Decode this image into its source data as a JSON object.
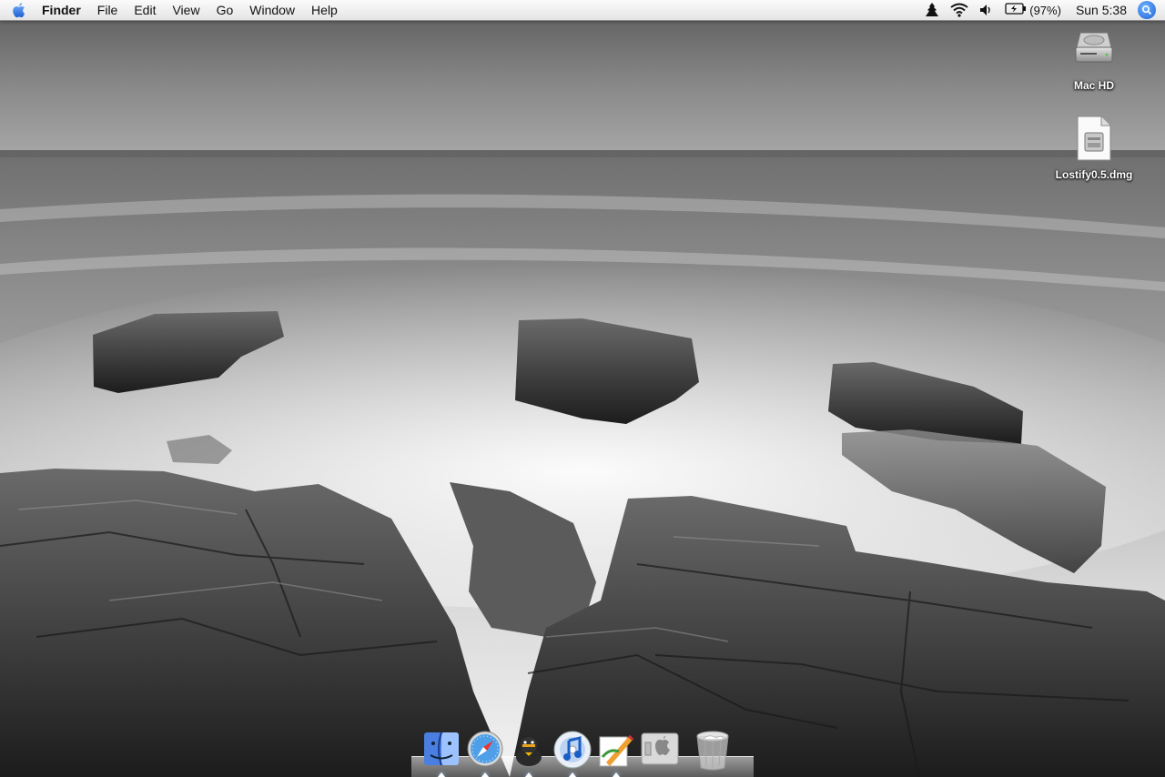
{
  "menubar": {
    "app_name": "Finder",
    "menus": [
      "File",
      "Edit",
      "View",
      "Go",
      "Window",
      "Help"
    ],
    "battery_percent": "(97%)",
    "clock": "Sun 5:38"
  },
  "desktop": {
    "icons": [
      {
        "label": "Mac HD",
        "icon": "hard-drive-icon"
      },
      {
        "label": "Lostify0.5.dmg",
        "icon": "disk-image-icon"
      }
    ]
  },
  "dock": {
    "items": [
      {
        "name": "finder",
        "running": true
      },
      {
        "name": "safari",
        "running": true
      },
      {
        "name": "adium",
        "running": true
      },
      {
        "name": "itunes",
        "running": true
      },
      {
        "name": "textedit-pen",
        "running": true
      },
      {
        "name": "system-preferences",
        "running": false
      },
      {
        "name": "trash",
        "running": false
      }
    ]
  }
}
